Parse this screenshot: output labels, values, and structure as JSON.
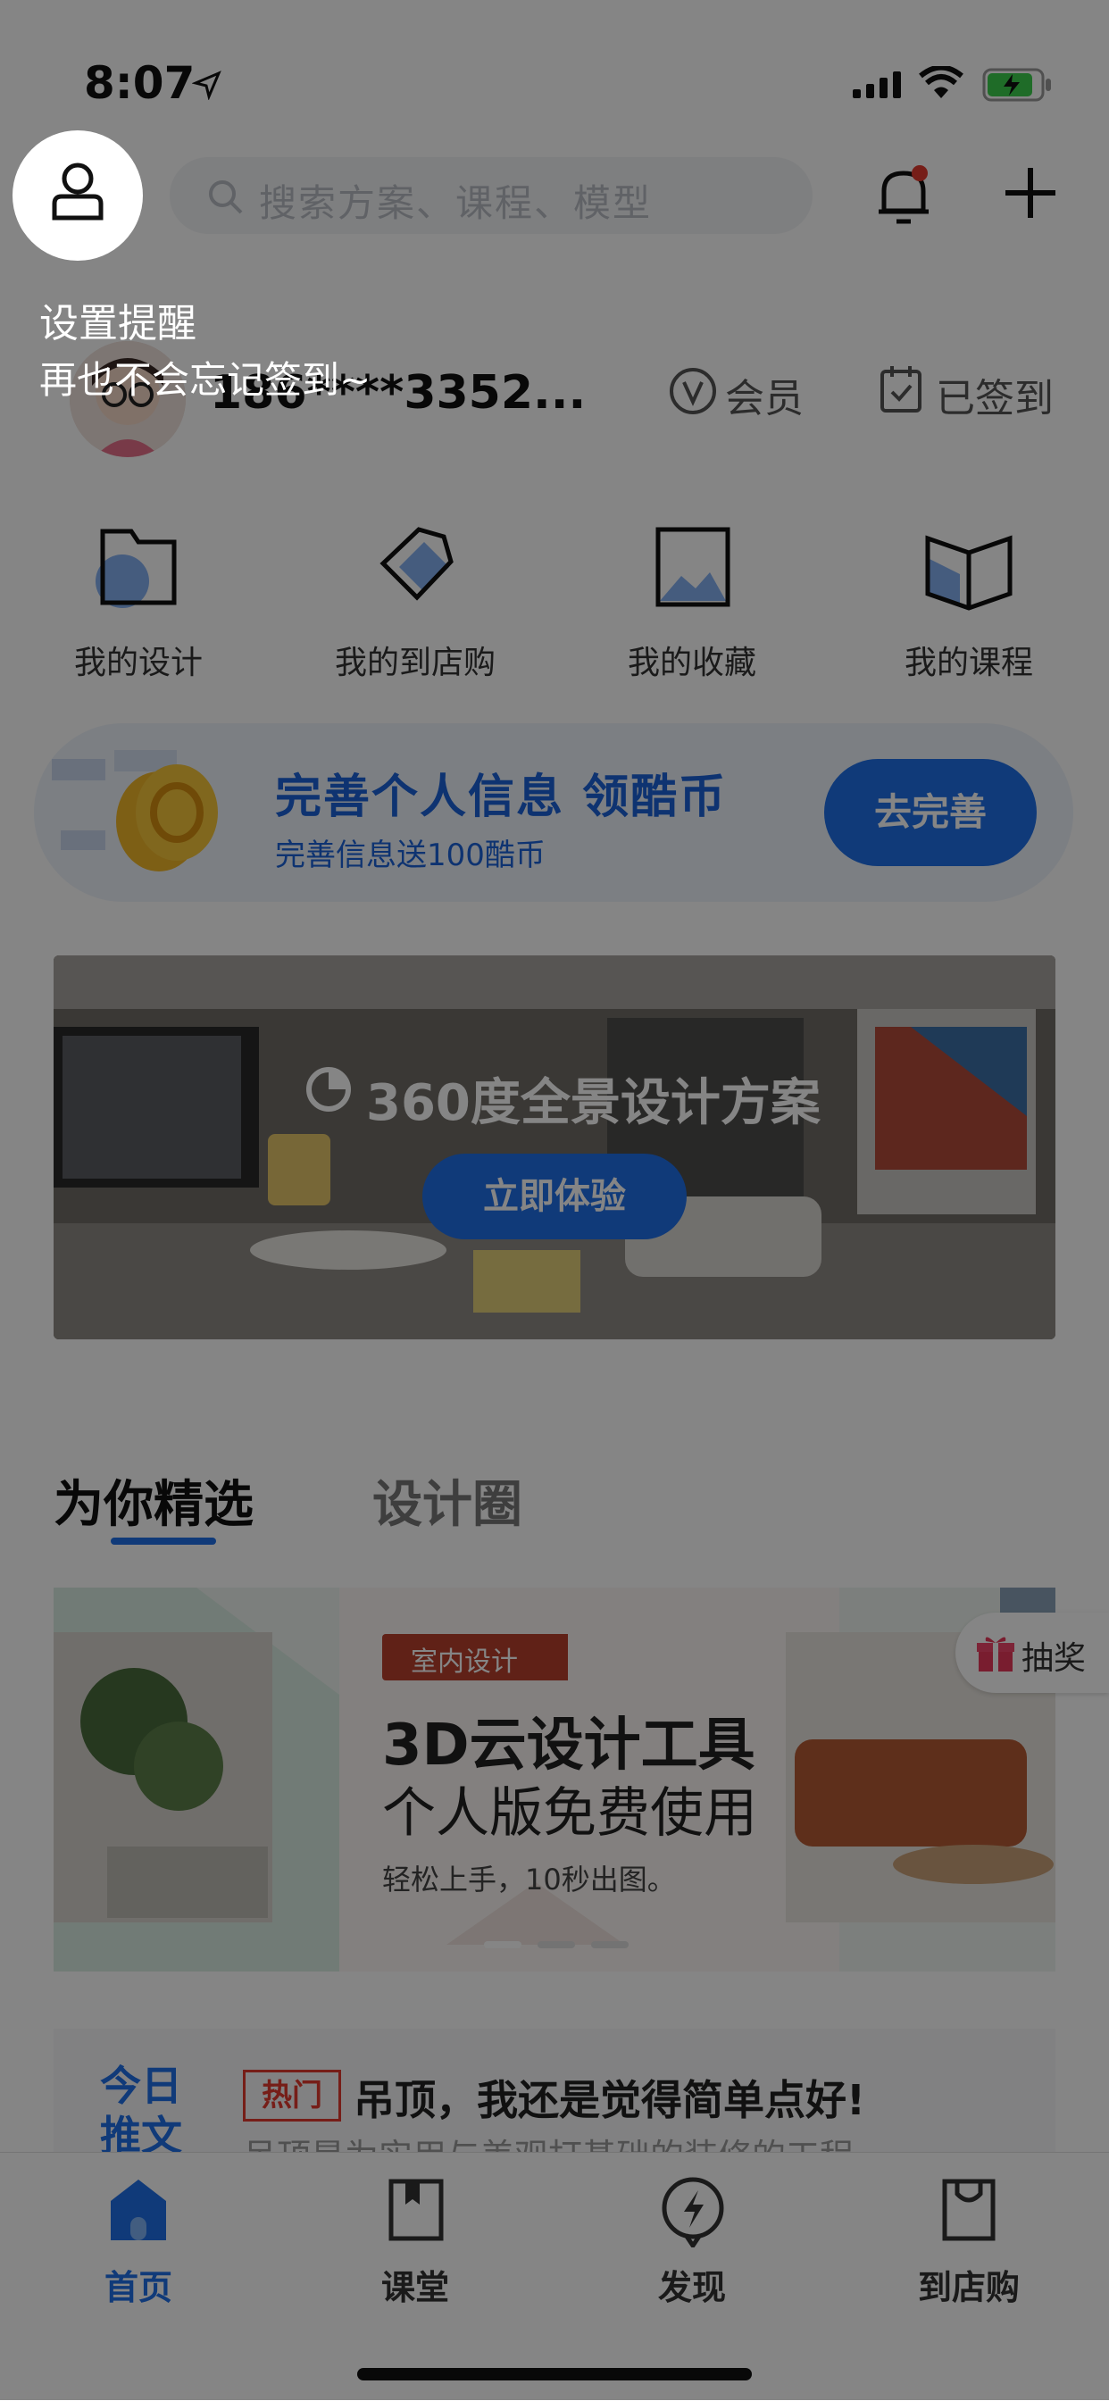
{
  "status_bar": {
    "time": "8:07"
  },
  "header": {
    "search_placeholder": "搜索方案、课程、模型"
  },
  "profile": {
    "user_id": "186****3352...",
    "vip_label": "会员",
    "signin_label": "已签到"
  },
  "quick_nav": [
    {
      "label": "我的设计",
      "icon": "folder-icon"
    },
    {
      "label": "我的到店购",
      "icon": "tag-icon"
    },
    {
      "label": "我的收藏",
      "icon": "picture-icon"
    },
    {
      "label": "我的课程",
      "icon": "book-icon"
    }
  ],
  "info_banner": {
    "title": "完善个人信息 领酷币",
    "subtitle": "完善信息送100酷币",
    "button": "去完善"
  },
  "panorama": {
    "title": "360度全景设计方案",
    "button": "立即体验"
  },
  "feed_tabs": [
    {
      "label": "为你精选",
      "active": true
    },
    {
      "label": "设计圈",
      "active": false
    }
  ],
  "promo_card": {
    "tag": "室内设计",
    "title": "3D云设计工具",
    "subtitle": "个人版免费使用",
    "desc": "轻松上手，10秒出图。"
  },
  "lottery": {
    "label": "抽奖"
  },
  "daily_post": {
    "badge_line1": "今日",
    "badge_line2": "推文",
    "hot": "热门",
    "title": "吊顶，我还是觉得简单点好!",
    "excerpt": "吊顶是为实用与美观打基础的装修的工程"
  },
  "tabbar": [
    {
      "label": "首页",
      "active": true,
      "icon": "home-icon"
    },
    {
      "label": "课堂",
      "active": false,
      "icon": "book-icon"
    },
    {
      "label": "发现",
      "active": false,
      "icon": "compass-icon"
    },
    {
      "label": "到店购",
      "active": false,
      "icon": "shopping-bag-icon"
    }
  ],
  "tooltip": {
    "title": "设置提醒",
    "subtitle": "再也不会忘记签到~"
  },
  "colors": {
    "brand_blue": "#1f6fe8",
    "hot_red": "#e23b2f"
  }
}
